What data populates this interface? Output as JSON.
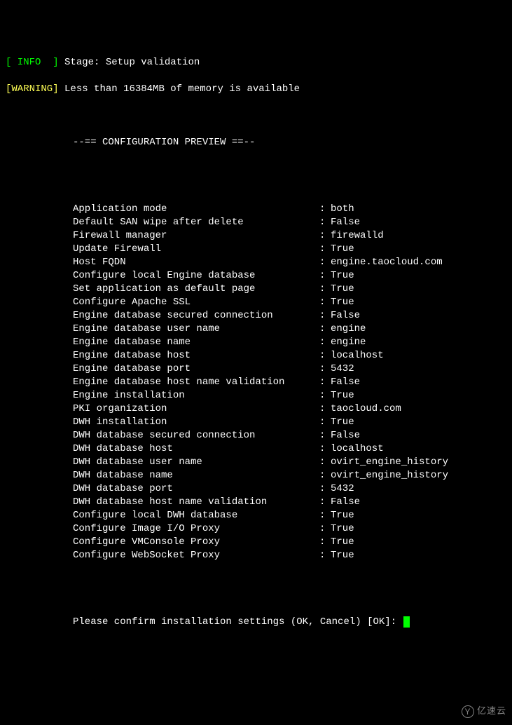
{
  "log": {
    "info_tag": "[ INFO  ]",
    "info_msg": "Stage: Setup validation",
    "warn_tag": "[WARNING]",
    "warn_msg": "Less than 16384MB of memory is available"
  },
  "section_header": "--== CONFIGURATION PREVIEW ==--",
  "config": [
    {
      "label": "Application mode",
      "value": "both"
    },
    {
      "label": "Default SAN wipe after delete",
      "value": "False"
    },
    {
      "label": "Firewall manager",
      "value": "firewalld"
    },
    {
      "label": "Update Firewall",
      "value": "True"
    },
    {
      "label": "Host FQDN",
      "value": "engine.taocloud.com"
    },
    {
      "label": "Configure local Engine database",
      "value": "True"
    },
    {
      "label": "Set application as default page",
      "value": "True"
    },
    {
      "label": "Configure Apache SSL",
      "value": "True"
    },
    {
      "label": "Engine database secured connection",
      "value": "False"
    },
    {
      "label": "Engine database user name",
      "value": "engine"
    },
    {
      "label": "Engine database name",
      "value": "engine"
    },
    {
      "label": "Engine database host",
      "value": "localhost"
    },
    {
      "label": "Engine database port",
      "value": "5432"
    },
    {
      "label": "Engine database host name validation",
      "value": "False"
    },
    {
      "label": "Engine installation",
      "value": "True"
    },
    {
      "label": "PKI organization",
      "value": "taocloud.com"
    },
    {
      "label": "DWH installation",
      "value": "True"
    },
    {
      "label": "DWH database secured connection",
      "value": "False"
    },
    {
      "label": "DWH database host",
      "value": "localhost"
    },
    {
      "label": "DWH database user name",
      "value": "ovirt_engine_history"
    },
    {
      "label": "DWH database name",
      "value": "ovirt_engine_history"
    },
    {
      "label": "DWH database port",
      "value": "5432"
    },
    {
      "label": "DWH database host name validation",
      "value": "False"
    },
    {
      "label": "Configure local DWH database",
      "value": "True"
    },
    {
      "label": "Configure Image I/O Proxy",
      "value": "True"
    },
    {
      "label": "Configure VMConsole Proxy",
      "value": "True"
    },
    {
      "label": "Configure WebSocket Proxy",
      "value": "True"
    }
  ],
  "prompt": "Please confirm installation settings (OK, Cancel) [OK]: ",
  "watermark": "亿速云"
}
